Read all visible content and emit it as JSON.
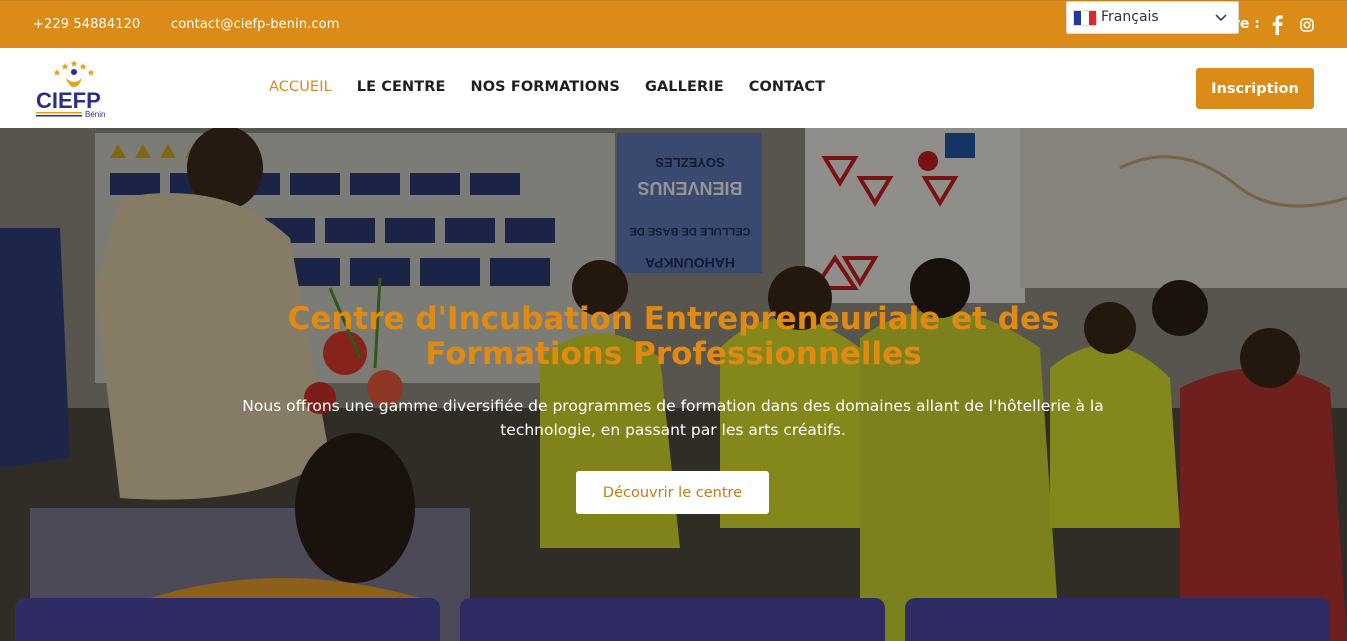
{
  "topbar": {
    "phone": "+229 54884120",
    "email": "contact@ciefp-benin.com",
    "follow_text": "re :",
    "social": [
      "facebook-icon",
      "instagram-icon"
    ]
  },
  "language": {
    "selected": "Français",
    "flag": [
      "#1f3c96",
      "#ffffff",
      "#e4262c"
    ]
  },
  "brand": {
    "logo_text": "CIEFP",
    "logo_subtext": "Bénin"
  },
  "nav": {
    "items": [
      {
        "label": "ACCUEIL",
        "active": true
      },
      {
        "label": "LE CENTRE",
        "active": false
      },
      {
        "label": "NOS FORMATIONS",
        "active": false
      },
      {
        "label": "GALLERIE",
        "active": false
      },
      {
        "label": "CONTACT",
        "active": false
      }
    ],
    "cta": "Inscription"
  },
  "hero": {
    "title_line1": "Centre d'Incubation Entrepreneuriale et des",
    "title_line2": "Formations Professionnelles",
    "subtitle_line1": "Nous offrons une gamme diversifiée de programmes de formation dans des domaines allant de l'hôtellerie à la",
    "subtitle_line2": "technologie, en passant par les arts créatifs.",
    "button": "Découvrir le centre",
    "sign_line1": "SOYEZLES",
    "sign_line2": "BIENVENUS",
    "sign_line3": "CELLULE DE BASE DE",
    "sign_line4": "HAHOUNKPA"
  },
  "colors": {
    "accent": "#db8b18",
    "card": "#2e2c63",
    "logo_blue": "#2a2f8a"
  }
}
